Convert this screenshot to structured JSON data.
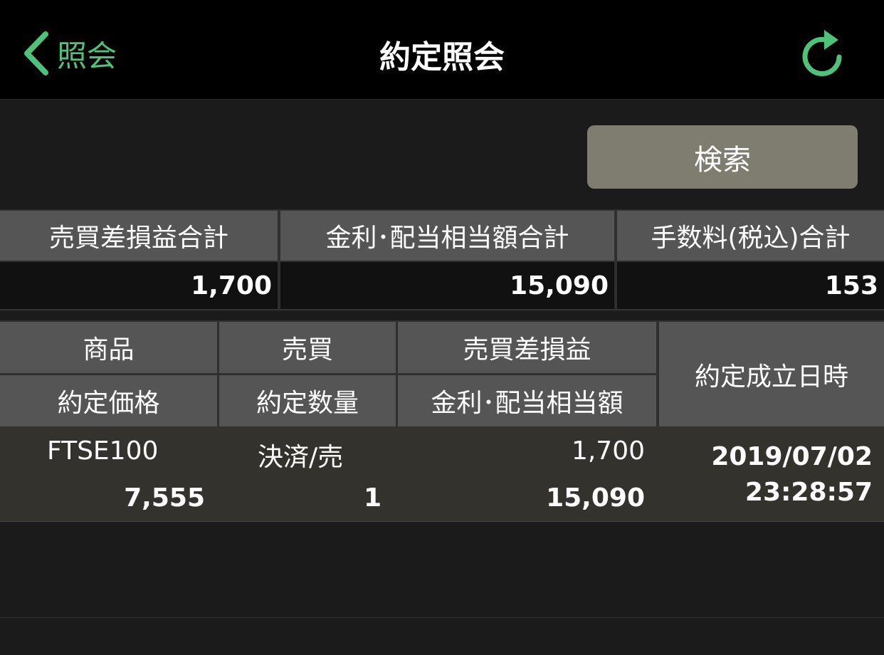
{
  "navbar": {
    "back_label": "照会",
    "title": "約定照会",
    "accent_color": "#4fc27a",
    "back_icon": "chevron-left-icon",
    "refresh_icon": "refresh-icon"
  },
  "search": {
    "button_label": "検索"
  },
  "summary": {
    "headers": [
      "売買差損益合計",
      "金利･配当相当額合計",
      "手数料(税込)合計"
    ],
    "values": [
      "1,700",
      "15,090",
      "153"
    ]
  },
  "detail": {
    "headers_row1": [
      "商品",
      "売買",
      "売買差損益"
    ],
    "headers_row2": [
      "約定価格",
      "約定数量",
      "金利･配当相当額"
    ],
    "header_datetime": "約定成立日時",
    "rows": [
      {
        "product": "FTSE100",
        "side": "決済/売",
        "pnl": "1,700",
        "price": "7,555",
        "quantity": "1",
        "interest": "15,090",
        "date": "2019/07/02",
        "time": "23:28:57"
      }
    ]
  }
}
